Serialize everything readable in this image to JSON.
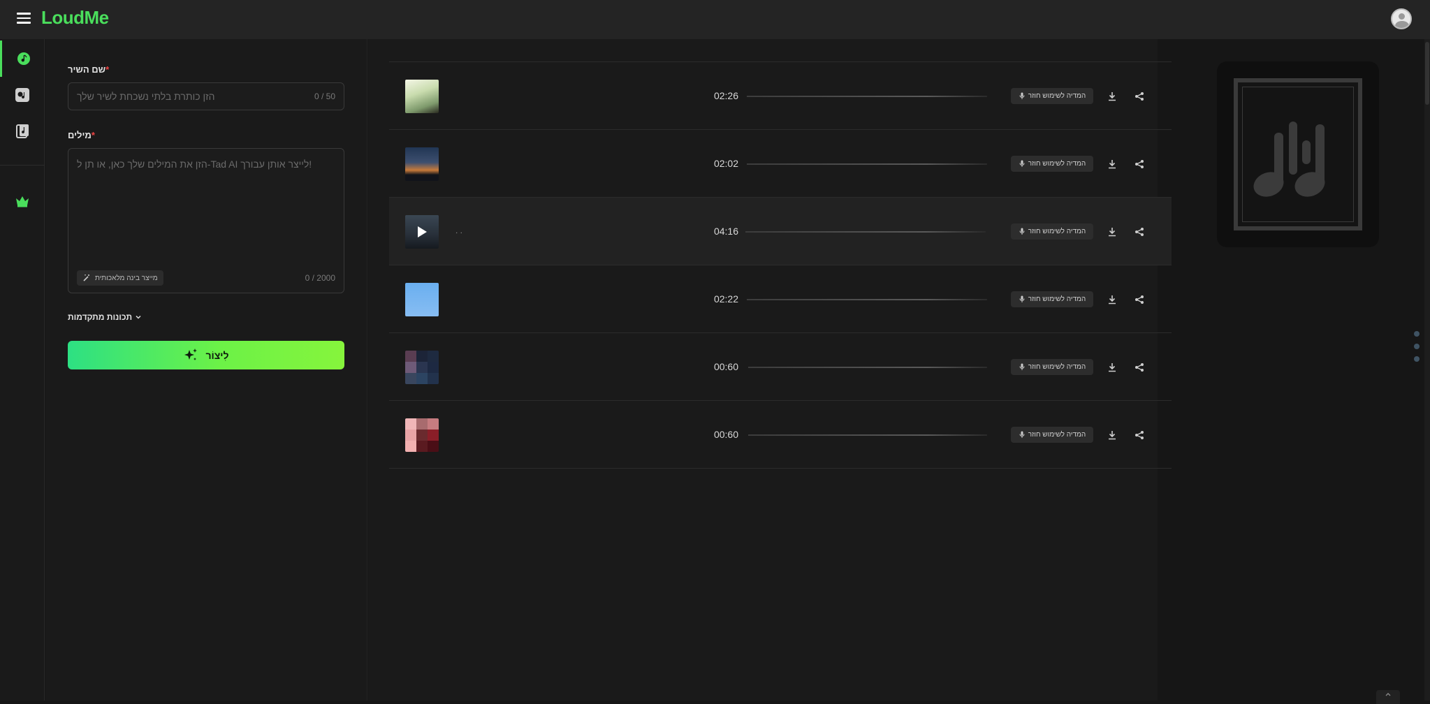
{
  "app": {
    "brand": "LoudMe"
  },
  "form": {
    "title_label": "שם השיר",
    "title_placeholder": "הזן כותרת בלתי נשכחת לשיר שלך",
    "title_counter": "0 / 50",
    "lyrics_label": "מילים",
    "lyrics_placeholder": "הזן את המילים שלך כאן, או תן ל-Tad AI לייצר אותן עבורך!",
    "lyrics_counter": "0 / 2000",
    "ai_generator_label": "מייצר בינה מלאכותית",
    "advanced_label": "תכונות מתקדמות",
    "create_label": "לִיצוֹר"
  },
  "tracks": [
    {
      "title": "",
      "duration": "02:26",
      "use_label": "המדיה לשימוש חוזר"
    },
    {
      "title": "",
      "duration": "02:02",
      "use_label": "המדיה לשימוש חוזר"
    },
    {
      "title": ". .",
      "duration": "04:16",
      "use_label": "המדיה לשימוש חוזר"
    },
    {
      "title": "",
      "duration": "02:22",
      "use_label": "המדיה לשימוש חוזר"
    },
    {
      "title": "",
      "duration": "00:60",
      "use_label": "המדיה לשימוש חוזר"
    },
    {
      "title": "",
      "duration": "00:60",
      "use_label": "המדיה לשימוש חוזר"
    }
  ],
  "icons": {
    "menu": "hamburger-icon",
    "music": "music-note-icon",
    "cover": "album-cover-icon",
    "library": "music-file-icon",
    "premium": "crown-icon",
    "download": "download-icon",
    "share": "share-icon",
    "play": "play-icon",
    "sparkle": "sparkles-icon",
    "wand": "magic-wand-icon",
    "mic": "microphone-icon"
  },
  "colors": {
    "accent": "#4ade5c",
    "background": "#161616",
    "panel": "#1a1a1a",
    "required": "#ef4444",
    "gradient_start": "#2de083",
    "gradient_end": "#86f43c"
  }
}
